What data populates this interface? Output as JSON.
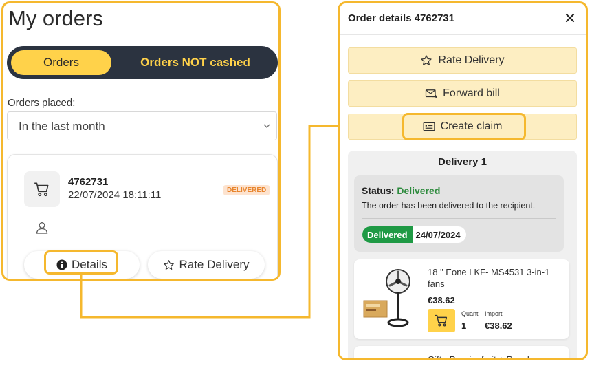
{
  "left": {
    "title": "My orders",
    "tabs": [
      {
        "label": "Orders",
        "active": true
      },
      {
        "label": "Orders NOT cashed",
        "active": false
      }
    ],
    "filter": {
      "label": "Orders placed:",
      "value": "In the last month"
    },
    "order": {
      "number": "4762731",
      "date": "22/07/2024 18:11:11",
      "status": "DELIVERED",
      "details_label": "Details",
      "rate_label": "Rate Delivery"
    }
  },
  "right": {
    "title": "Order details 4762731",
    "actions": {
      "rate": "Rate Delivery",
      "forward": "Forward bill",
      "claim": "Create claim"
    },
    "delivery": {
      "title": "Delivery 1",
      "status_key": "Status:",
      "status_value": "Delivered",
      "status_description": "The order has been delivered to the recipient.",
      "chip_status": "Delivered",
      "chip_date": "24/07/2024"
    },
    "products": [
      {
        "name": "18 \" Eone LKF- MS4531 3-in-1 fans",
        "price": "€38.62",
        "quant_label": "Quant",
        "quant": "1",
        "import_label": "Import",
        "import": "€38.62"
      },
      {
        "name": "Gift - Passionfruit + Raspberry"
      }
    ]
  },
  "colors": {
    "highlight": "#f5b82e",
    "toggle_bg": "#2b3340",
    "accent_yellow": "#ffd24a",
    "action_bg": "#fdeec2",
    "delivered_green": "#1f9a45",
    "badge_bg": "#fde3cf",
    "badge_text": "#e8852d"
  }
}
